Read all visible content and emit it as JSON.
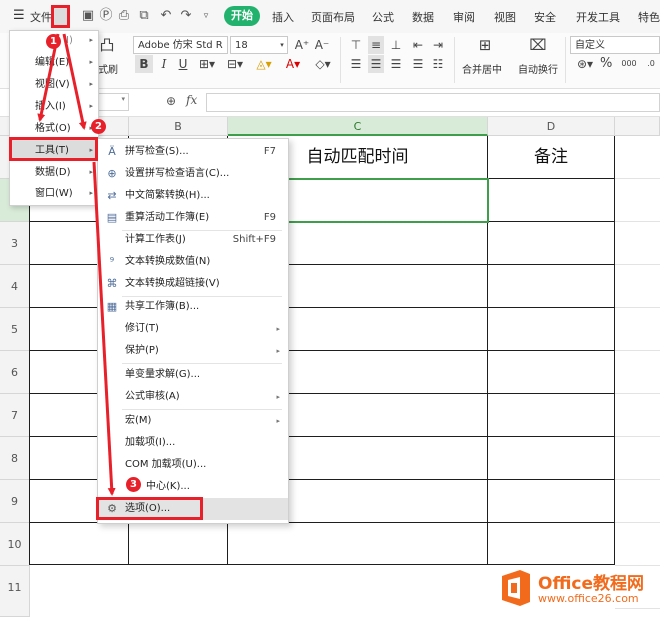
{
  "menubar": {
    "file_label": "文件",
    "tabs": [
      "插入",
      "页面布局",
      "公式",
      "数据",
      "审阅",
      "视图",
      "安全",
      "开发工具",
      "特色"
    ],
    "active_tab": "开始"
  },
  "ribbon": {
    "format_painter_partial": "式刷",
    "font_name": "Adobe 仿宋 Std R",
    "font_size": "18",
    "merge_label": "合并居中",
    "wrap_label": "自动换行",
    "number_format": "自定义",
    "percent_symbol": "%"
  },
  "formula_bar": {
    "fx_label": "fx",
    "value": ""
  },
  "grid": {
    "columns": [
      "B",
      "C",
      "D"
    ],
    "rows": [
      "3",
      "4",
      "5",
      "6",
      "7",
      "8",
      "9",
      "10",
      "11"
    ],
    "header_cells": {
      "c": "自动匹配时间",
      "d": "备注"
    }
  },
  "file_menu": {
    "items": [
      {
        "label": "编辑(E)"
      },
      {
        "label": "视图(V)"
      },
      {
        "label": "插入(I)"
      },
      {
        "label": "格式(O)"
      },
      {
        "label": "工具(T)"
      },
      {
        "label": "数据(D)"
      },
      {
        "label": "窗口(W)"
      }
    ],
    "top_partial": "I)"
  },
  "tools_menu": {
    "items": [
      {
        "label": "拼写检查(S)...",
        "shortcut": "F7",
        "icon": "spellcheck-icon"
      },
      {
        "label": "设置拼写检查语言(C)...",
        "shortcut": "",
        "icon": "globe-icon"
      },
      {
        "label": "中文简繁转换(H)...",
        "shortcut": "",
        "icon": "convert-icon"
      },
      {
        "label": "重算活动工作簿(E)",
        "shortcut": "F9",
        "icon": "recalc-icon"
      },
      {
        "label": "计算工作表(J)",
        "shortcut": "Shift+F9",
        "icon": ""
      },
      {
        "label": "文本转换成数值(N)",
        "shortcut": "",
        "icon": "text-to-number-icon"
      },
      {
        "label": "文本转换成超链接(V)",
        "shortcut": "",
        "icon": "text-to-link-icon"
      },
      {
        "label": "共享工作簿(B)...",
        "shortcut": "",
        "icon": "share-workbook-icon"
      },
      {
        "label": "修订(T)",
        "shortcut": "",
        "icon": "",
        "submenu": true
      },
      {
        "label": "保护(P)",
        "shortcut": "",
        "icon": "",
        "submenu": true
      },
      {
        "label": "单变量求解(G)...",
        "shortcut": "",
        "icon": ""
      },
      {
        "label": "公式审核(A)",
        "shortcut": "",
        "icon": "",
        "submenu": true
      },
      {
        "label": "宏(M)",
        "shortcut": "",
        "icon": "",
        "submenu": true
      },
      {
        "label": "加载项(I)...",
        "shortcut": "",
        "icon": ""
      },
      {
        "label": "COM 加载项(U)...",
        "shortcut": "",
        "icon": ""
      },
      {
        "label": "中心(K)...",
        "shortcut": "",
        "icon": ""
      },
      {
        "label": "选项(O)...",
        "shortcut": "",
        "icon": "gear-icon"
      }
    ]
  },
  "annotations": {
    "badges": [
      "1",
      "2",
      "3"
    ],
    "color": "#e8202a"
  },
  "watermark": {
    "brand": "Office教程网",
    "url": "www.office26.com"
  },
  "colors": {
    "accent_green": "#23b26d",
    "selection_green": "#3f9e4b",
    "annotation_red": "#e8202a",
    "logo_orange": "#f26b1d"
  }
}
